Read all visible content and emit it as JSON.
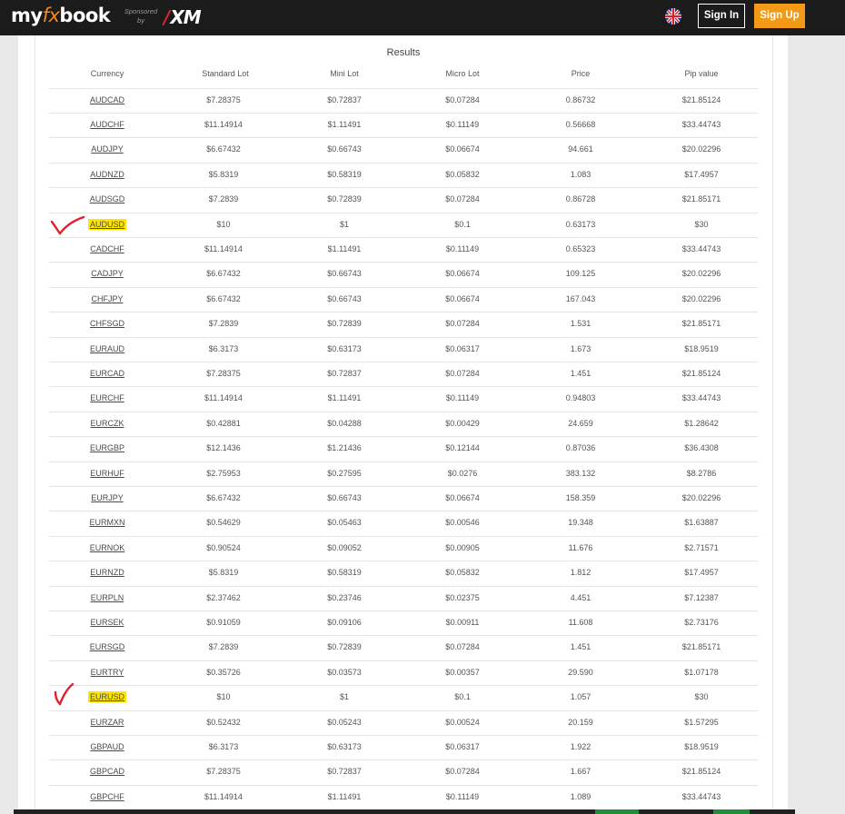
{
  "header": {
    "logo_prefix": "my",
    "logo_fx": "fx",
    "logo_suffix": "book",
    "sponsored_line1": "Sponsored",
    "sponsored_line2": "by",
    "sponsor_brand": "XM",
    "sign_in_label": "Sign In",
    "sign_up_label": "Sign Up",
    "language_flag": "uk-flag-icon"
  },
  "results": {
    "title": "Results",
    "columns": [
      "Currency",
      "Standard Lot",
      "Mini Lot",
      "Micro Lot",
      "Price",
      "Pip value"
    ],
    "rows": [
      [
        "AUDCAD",
        "$7.28375",
        "$0.72837",
        "$0.07284",
        "0.86732",
        "$21.85124"
      ],
      [
        "AUDCHF",
        "$11.14914",
        "$1.11491",
        "$0.11149",
        "0.56668",
        "$33.44743"
      ],
      [
        "AUDJPY",
        "$6.67432",
        "$0.66743",
        "$0.06674",
        "94.661",
        "$20.02296"
      ],
      [
        "AUDNZD",
        "$5.8319",
        "$0.58319",
        "$0.05832",
        "1.083",
        "$17.4957"
      ],
      [
        "AUDSGD",
        "$7.2839",
        "$0.72839",
        "$0.07284",
        "0.86728",
        "$21.85171"
      ],
      [
        "AUDUSD",
        "$10",
        "$1",
        "$0.1",
        "0.63173",
        "$30"
      ],
      [
        "CADCHF",
        "$11.14914",
        "$1.11491",
        "$0.11149",
        "0.65323",
        "$33.44743"
      ],
      [
        "CADJPY",
        "$6.67432",
        "$0.66743",
        "$0.06674",
        "109.125",
        "$20.02296"
      ],
      [
        "CHFJPY",
        "$6.67432",
        "$0.66743",
        "$0.06674",
        "167.043",
        "$20.02296"
      ],
      [
        "CHFSGD",
        "$7.2839",
        "$0.72839",
        "$0.07284",
        "1.531",
        "$21.85171"
      ],
      [
        "EURAUD",
        "$6.3173",
        "$0.63173",
        "$0.06317",
        "1.673",
        "$18.9519"
      ],
      [
        "EURCAD",
        "$7.28375",
        "$0.72837",
        "$0.07284",
        "1.451",
        "$21.85124"
      ],
      [
        "EURCHF",
        "$11.14914",
        "$1.11491",
        "$0.11149",
        "0.94803",
        "$33.44743"
      ],
      [
        "EURCZK",
        "$0.42881",
        "$0.04288",
        "$0.00429",
        "24.659",
        "$1.28642"
      ],
      [
        "EURGBP",
        "$12.1436",
        "$1.21436",
        "$0.12144",
        "0.87036",
        "$36.4308"
      ],
      [
        "EURHUF",
        "$2.75953",
        "$0.27595",
        "$0.0276",
        "383.132",
        "$8.2786"
      ],
      [
        "EURJPY",
        "$6.67432",
        "$0.66743",
        "$0.06674",
        "158.359",
        "$20.02296"
      ],
      [
        "EURMXN",
        "$0.54629",
        "$0.05463",
        "$0.00546",
        "19.348",
        "$1.63887"
      ],
      [
        "EURNOK",
        "$0.90524",
        "$0.09052",
        "$0.00905",
        "11.676",
        "$2.71571"
      ],
      [
        "EURNZD",
        "$5.8319",
        "$0.58319",
        "$0.05832",
        "1.812",
        "$17.4957"
      ],
      [
        "EURPLN",
        "$2.37462",
        "$0.23746",
        "$0.02375",
        "4.451",
        "$7.12387"
      ],
      [
        "EURSEK",
        "$0.91059",
        "$0.09106",
        "$0.00911",
        "11.608",
        "$2.73176"
      ],
      [
        "EURSGD",
        "$7.2839",
        "$0.72839",
        "$0.07284",
        "1.451",
        "$21.85171"
      ],
      [
        "EURTRY",
        "$0.35726",
        "$0.03573",
        "$0.00357",
        "29.590",
        "$1.07178"
      ],
      [
        "EURUSD",
        "$10",
        "$1",
        "$0.1",
        "1.057",
        "$30"
      ],
      [
        "EURZAR",
        "$0.52432",
        "$0.05243",
        "$0.00524",
        "20.159",
        "$1.57295"
      ],
      [
        "GBPAUD",
        "$6.3173",
        "$0.63173",
        "$0.06317",
        "1.922",
        "$18.9519"
      ],
      [
        "GBPCAD",
        "$7.28375",
        "$0.72837",
        "$0.07284",
        "1.667",
        "$21.85124"
      ],
      [
        "GBPCHF",
        "$11.14914",
        "$1.11491",
        "$0.11149",
        "1.089",
        "$33.44743"
      ]
    ],
    "highlighted_rows": [
      "AUDUSD",
      "EURUSD"
    ]
  },
  "colors": {
    "topbar": "#1b1b1b",
    "accent_orange": "#f29a18",
    "highlight": "#ffe600",
    "annotation_red": "#e0202a"
  }
}
